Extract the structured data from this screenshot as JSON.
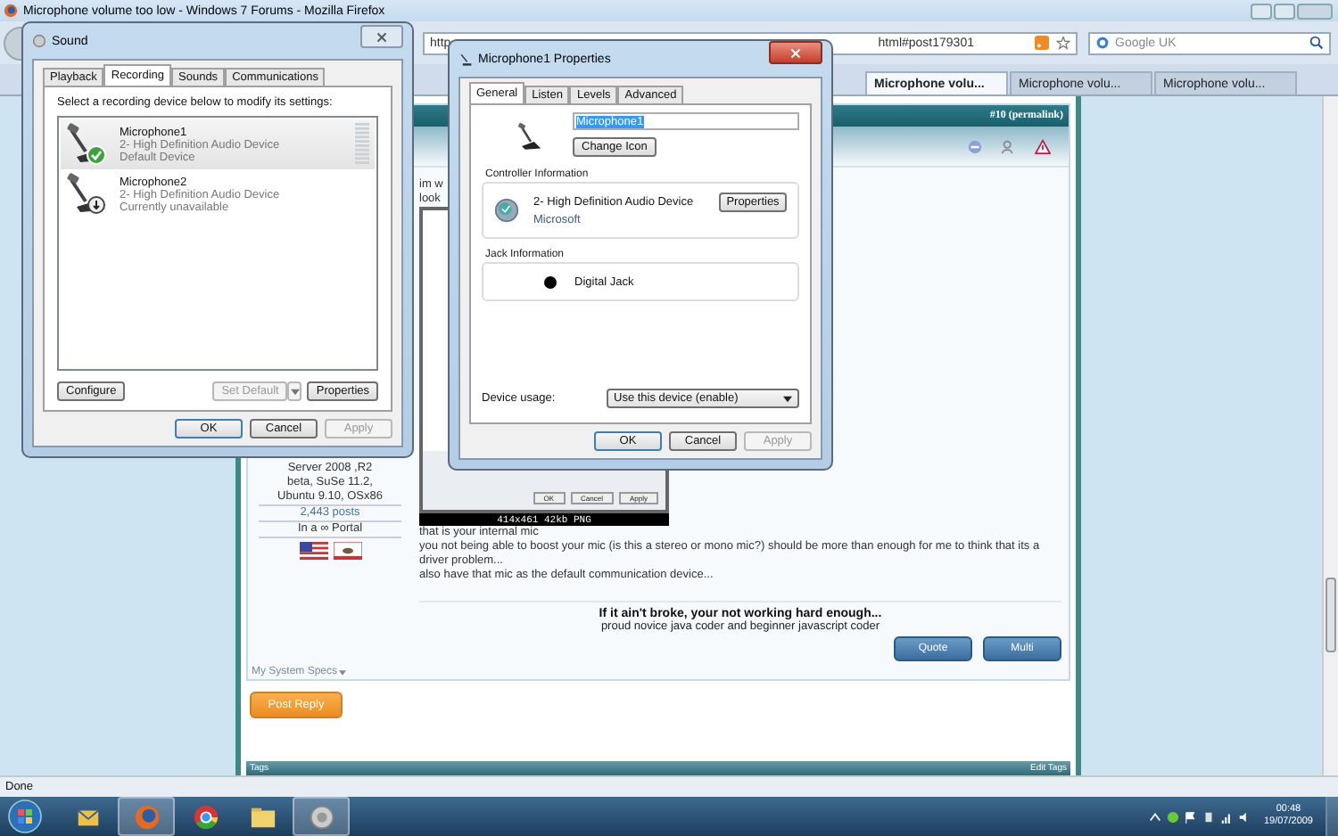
{
  "browser": {
    "title": "Microphone volume too low - Windows 7 Forums - Mozilla Firefox",
    "url_prefix": "http",
    "url_suffix": "html#post179301",
    "search_placeholder": "Google UK",
    "tabs": [
      {
        "label": "Microphone volu...",
        "selected": true
      },
      {
        "label": "Microphone volu...",
        "selected": false
      },
      {
        "label": "Microphone volu...",
        "selected": false
      }
    ],
    "status": "Done"
  },
  "post": {
    "permalink": "#10 (permalink)",
    "fragments": [
      "im w",
      "look"
    ],
    "user_info": [
      "Server 2008 ,R2",
      "beta, SuSe 11.2,",
      "Ubuntu 9.10, OSx86"
    ],
    "post_count": "2,443 posts",
    "location": "In a ∞ Portal",
    "thumbnail_buttons": [
      "OK",
      "Cancel",
      "Apply"
    ],
    "image_caption": "414x461 42kb PNG",
    "paragraphs": [
      "that is your internal mic",
      "you not being able to boost your mic (is this a stereo or mono mic?) should be more than enough for me to think that its a driver problem...",
      "also have that mic as the default communication device..."
    ],
    "signature_title": "If it ain't broke, your not working hard enough...",
    "signature_line": "proud novice java coder and beginner javascript coder",
    "buttons": [
      "Quote",
      "Multi"
    ],
    "specs_link": "My System Specs"
  },
  "post_reply": "Post Reply",
  "tags_bar": {
    "label": "Tags",
    "edit": "Edit Tags"
  },
  "sound_dialog": {
    "title": "Sound",
    "tabs": [
      {
        "label": "Playback",
        "selected": false
      },
      {
        "label": "Recording",
        "selected": true
      },
      {
        "label": "Sounds",
        "selected": false
      },
      {
        "label": "Communications",
        "selected": false
      }
    ],
    "instruction": "Select a recording device below to modify its settings:",
    "devices": [
      {
        "name": "Microphone1",
        "driver": "2- High Definition Audio Device",
        "status": "Default Device",
        "kind": "default",
        "selected": true
      },
      {
        "name": "Microphone2",
        "driver": "2- High Definition Audio Device",
        "status": "Currently unavailable",
        "kind": "unavailable",
        "selected": false
      }
    ],
    "buttons": [
      {
        "label": "Configure",
        "disabled": false
      },
      {
        "label": "Set Default",
        "disabled": true
      },
      {
        "label": "Properties",
        "disabled": false
      }
    ],
    "footer": [
      {
        "label": "OK",
        "disabled": false
      },
      {
        "label": "Cancel",
        "disabled": false
      },
      {
        "label": "Apply",
        "disabled": true
      }
    ]
  },
  "properties_dialog": {
    "title": "Microphone1 Properties",
    "tabs": [
      {
        "label": "General",
        "selected": true
      },
      {
        "label": "Listen",
        "selected": false
      },
      {
        "label": "Levels",
        "selected": false
      },
      {
        "label": "Advanced",
        "selected": false
      }
    ],
    "name_value": "Microphone1",
    "change_icon": "Change Icon",
    "controller_heading": "Controller Information",
    "controller_name": "2- High Definition Audio Device",
    "controller_button": "Properties",
    "controller_vendor": "Microsoft",
    "jack_heading": "Jack Information",
    "jack": {
      "label": "Digital Jack",
      "color": "#000000"
    },
    "usage_label": "Device usage:",
    "usage_value": "Use this device (enable)",
    "footer": [
      {
        "label": "OK",
        "disabled": false
      },
      {
        "label": "Cancel",
        "disabled": false
      },
      {
        "label": "Apply",
        "disabled": true
      }
    ]
  },
  "taskbar": {
    "apps": [
      {
        "kind": "mail",
        "active": false
      },
      {
        "kind": "firefox",
        "active": true
      },
      {
        "kind": "chrome",
        "active": false
      },
      {
        "kind": "folder",
        "active": false
      },
      {
        "kind": "sound",
        "active": true
      }
    ],
    "time": "00:48",
    "date": "19/07/2009"
  }
}
